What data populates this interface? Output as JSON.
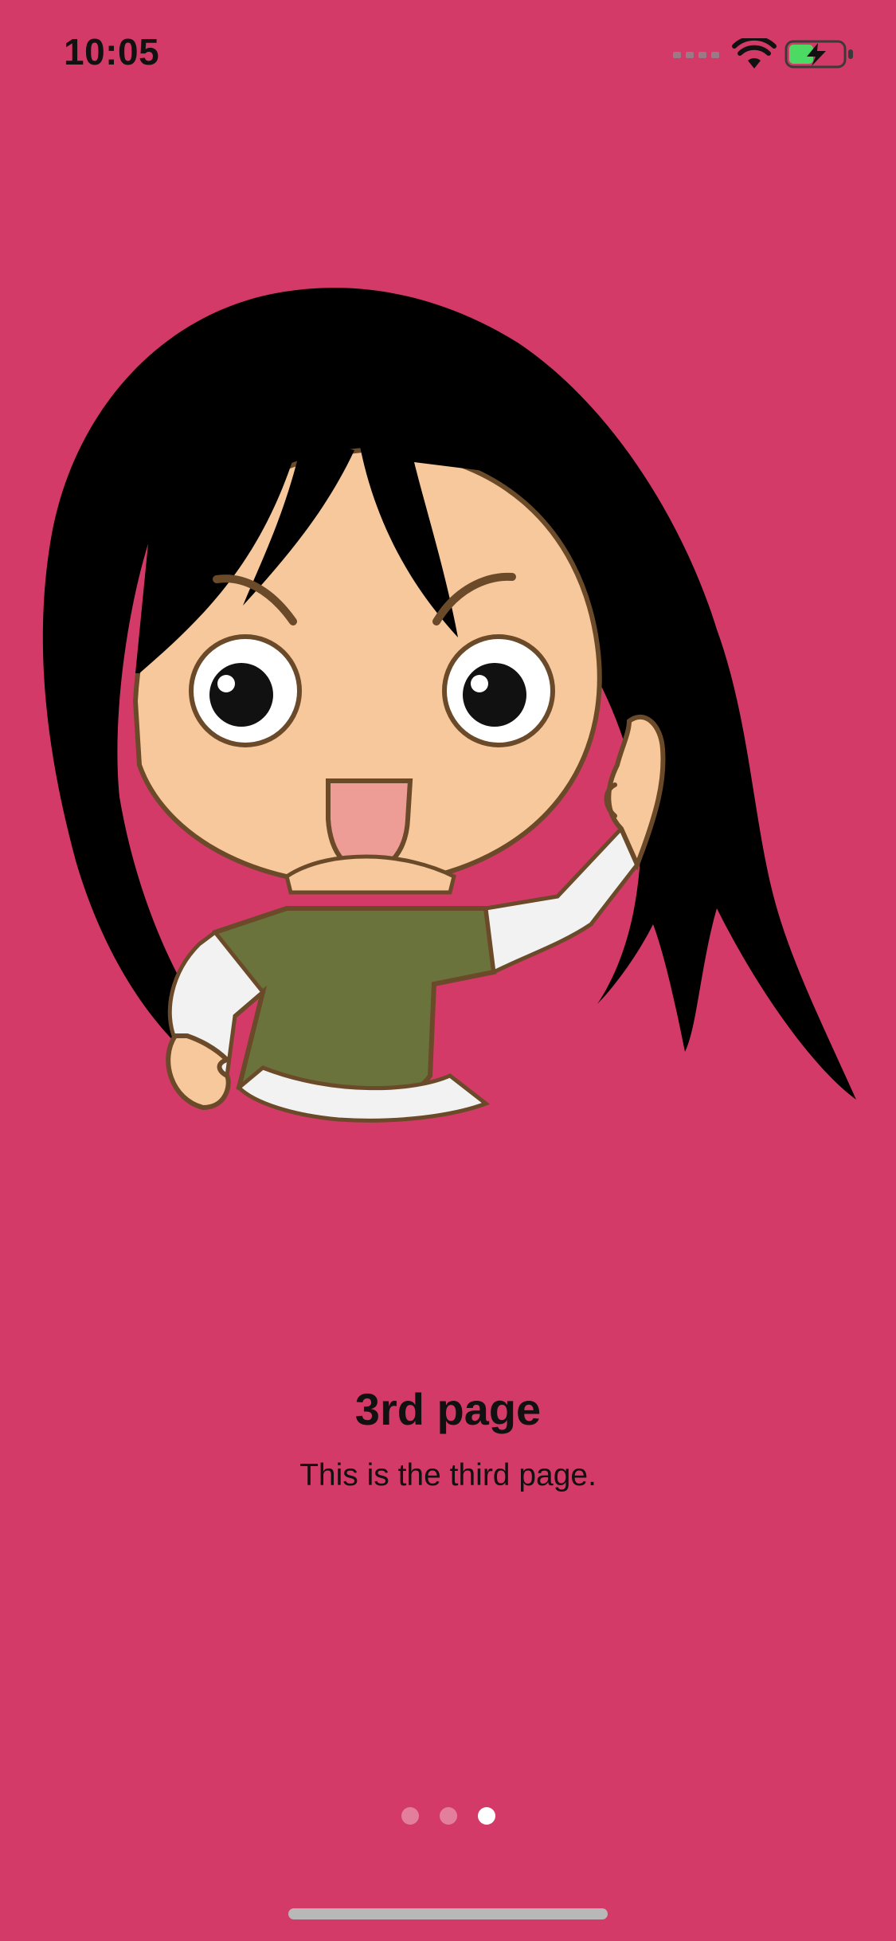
{
  "status_bar": {
    "time": "10:05",
    "icons": [
      "cellular-signal-icon",
      "wifi-icon",
      "battery-charging-icon"
    ]
  },
  "colors": {
    "background": "#D43A67",
    "text": "#111111",
    "dot_active": "#FFFFFF",
    "dot_inactive": "rgba(255,255,255,0.35)",
    "home_indicator": "#B8B8B8"
  },
  "content": {
    "title": "3rd page",
    "subtitle": "This is the third page."
  },
  "pager": {
    "total": 3,
    "current": 3
  }
}
